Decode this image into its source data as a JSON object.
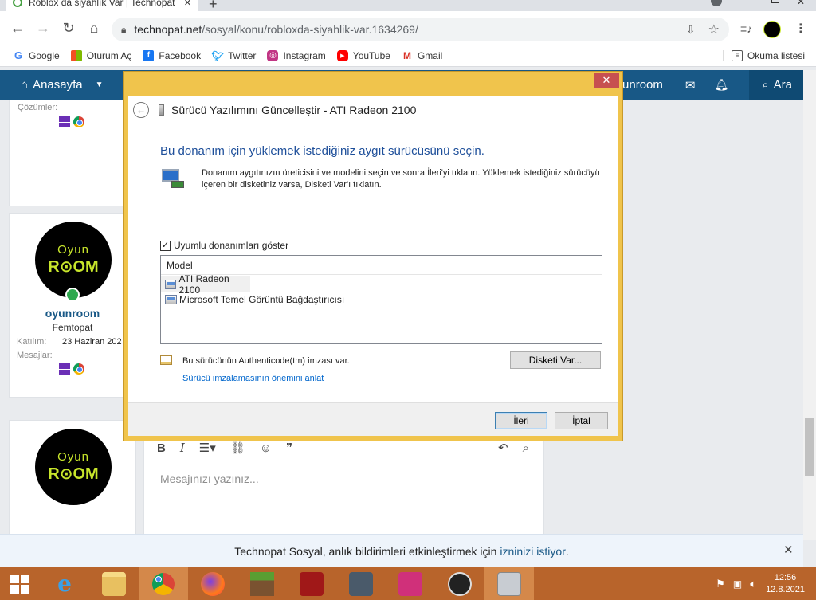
{
  "browser": {
    "tab_title": "Roblox da siyahlık Var | Technopat",
    "new_tab": "+",
    "url_host": "technopat.net",
    "url_path": "/sosyal/konu/robloxda-siyahlik-var.1634269/",
    "bookmarks": [
      {
        "label": "Google",
        "icon": "google-icon",
        "color": "#4285f4"
      },
      {
        "label": "Oturum Aç",
        "icon": "microsoft-icon",
        "color": "#f25022"
      },
      {
        "label": "Facebook",
        "icon": "facebook-icon",
        "color": "#1877f2"
      },
      {
        "label": "Twitter",
        "icon": "twitter-icon",
        "color": "#1da1f2"
      },
      {
        "label": "Instagram",
        "icon": "instagram-icon",
        "color": "#c13584"
      },
      {
        "label": "YouTube",
        "icon": "youtube-icon",
        "color": "#ff0000"
      },
      {
        "label": "Gmail",
        "icon": "gmail-icon",
        "color": "#d93025"
      }
    ],
    "reading_list": "Okuma listesi"
  },
  "site": {
    "nav_home": "Anasayfa",
    "nav_user": "oyunroom",
    "nav_search": "Ara",
    "accent": "#185886",
    "sidebar_top": {
      "solutions_label": "Çözümler:"
    },
    "profile": {
      "avatar_line1": "Oyun",
      "avatar_line2": "R⊙OM",
      "username": "oyunroom",
      "rank": "Femtopat",
      "joined_label": "Katılım:",
      "joined_value": "23 Haziran 202",
      "messages_label": "Mesajlar:"
    },
    "reply_avatar_line1": "Oyun",
    "reply_avatar_line2": "R⊙OM",
    "editor_placeholder": "Mesajınızı yazınız...",
    "notification_text": "Technopat Sosyal, anlık bildirimleri etkinleştirmek için",
    "notification_link": "izninizi istiyor",
    "notification_end": "."
  },
  "dialog": {
    "title": "Sürücü Yazılımını Güncelleştir - ATI Radeon 2100",
    "heading": "Bu donanım için yüklemek istediğiniz aygıt sürücüsünü seçin.",
    "description": "Donanım aygıtınızın üreticisini ve modelini seçin ve sonra İleri'yi tıklatın. Yüklemek istediğiniz sürücüyü içeren bir disketiniz varsa, Disketi Var'ı tıklatın.",
    "checkbox_label": "Uyumlu donanımları göster",
    "checkbox_checked": true,
    "list_header": "Model",
    "models": [
      "ATI Radeon 2100",
      "Microsoft Temel Görüntü Bağdaştırıcısı"
    ],
    "selected_model": "ATI Radeon 2100",
    "signature_text": "Bu sürücünün Authenticode(tm) imzası var.",
    "signature_link": "Sürücü imzalamasının önemini anlat",
    "disk_button": "Disketi Var...",
    "next_button": "İleri",
    "cancel_button": "İptal",
    "close_button": "✕"
  },
  "taskbar": {
    "time": "12:56",
    "date": "12.8.2021"
  }
}
